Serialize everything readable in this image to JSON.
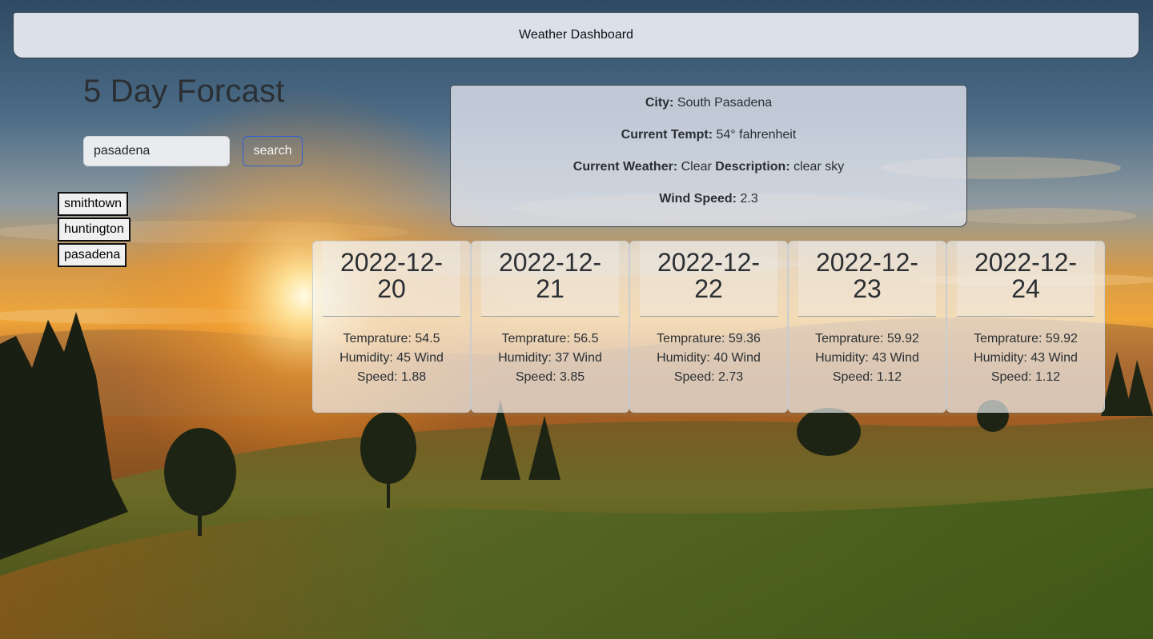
{
  "header": {
    "title": "Weather Dashboard"
  },
  "main": {
    "title": "5 Day Forcast"
  },
  "search": {
    "value": "pasadena",
    "button_label": "search"
  },
  "history": [
    "smithtown",
    "huntington",
    "pasadena"
  ],
  "current": {
    "city_label": "City:",
    "city": "South Pasadena",
    "temp_label": "Current Tempt:",
    "temp": "54° fahrenheit",
    "weather_label": "Current Weather:",
    "weather": "Clear",
    "description_label": "Description:",
    "description": "clear sky",
    "wind_label": "Wind Speed:",
    "wind": "2.3"
  },
  "forecast": [
    {
      "date_line1": "2022-12-",
      "date_line2": "20",
      "temp": "Temprature: 54.5",
      "humidity_wind": "Humidity: 45 Wind",
      "speed": "Speed: 1.88"
    },
    {
      "date_line1": "2022-12-",
      "date_line2": "21",
      "temp": "Temprature: 56.5",
      "humidity_wind": "Humidity: 37 Wind",
      "speed": "Speed: 3.85"
    },
    {
      "date_line1": "2022-12-",
      "date_line2": "22",
      "temp": "Temprature: 59.36",
      "humidity_wind": "Humidity: 40 Wind",
      "speed": "Speed: 2.73"
    },
    {
      "date_line1": "2022-12-",
      "date_line2": "23",
      "temp": "Temprature: 59.92",
      "humidity_wind": "Humidity: 43 Wind",
      "speed": "Speed: 1.12"
    },
    {
      "date_line1": "2022-12-",
      "date_line2": "24",
      "temp": "Temprature: 59.92",
      "humidity_wind": "Humidity: 43 Wind",
      "speed": "Speed: 1.12"
    }
  ]
}
